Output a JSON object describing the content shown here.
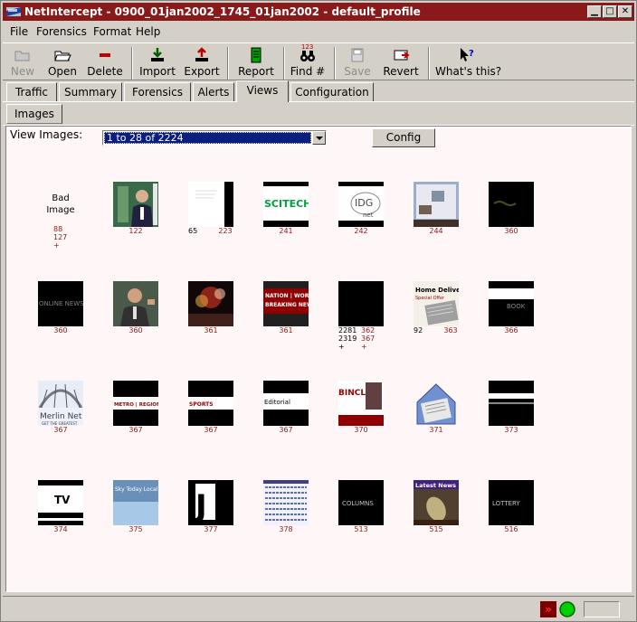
{
  "window": {
    "title": "NetIntercept - 0900_01jan2002_1745_01jan2002 - default_profile"
  },
  "menu": [
    "File",
    "Forensics",
    "Format",
    "Help"
  ],
  "toolbar": {
    "new": "New",
    "open": "Open",
    "delete": "Delete",
    "import": "Import",
    "export": "Export",
    "report": "Report",
    "find": "Find #",
    "find_badge": "123",
    "save": "Save",
    "revert": "Revert",
    "whats_this": "What's this?"
  },
  "tabs": [
    "Traffic",
    "Summary",
    "Forensics",
    "Alerts",
    "Views",
    "Configuration"
  ],
  "active_tab": "Views",
  "subtabs": [
    "Images"
  ],
  "view_images": {
    "label": "View Images:",
    "selected": "1 to 28 of 2224",
    "config_button": "Config"
  },
  "thumbnails": [
    {
      "kind": "bad",
      "label1": "Bad",
      "label2": "Image",
      "nums": [
        "88",
        "127",
        "+"
      ]
    },
    {
      "kind": "photo-man",
      "caption": "122"
    },
    {
      "kind": "doc",
      "caption_left": "65",
      "caption": "223"
    },
    {
      "kind": "scitech",
      "caption": "241",
      "text": "SCITECH"
    },
    {
      "kind": "idg",
      "caption": "242",
      "text": "IDG",
      "subtext": "net"
    },
    {
      "kind": "screenshot",
      "caption": "244"
    },
    {
      "kind": "dark-dots",
      "caption": "360"
    },
    {
      "kind": "dark-text",
      "caption": "360",
      "text": "ONLINE NEWS"
    },
    {
      "kind": "photo-man2",
      "caption": "360"
    },
    {
      "kind": "fireworks",
      "caption": "361"
    },
    {
      "kind": "breaking",
      "caption": "361",
      "text": "NATION | WORLD BREAKING NEWS"
    },
    {
      "kind": "black",
      "nums_left": [
        "2281",
        "2319",
        "+"
      ],
      "nums_right": [
        "362",
        "367",
        "+"
      ]
    },
    {
      "kind": "home-delivery",
      "caption_left": "92",
      "caption": "363",
      "text": "Home Delivery",
      "subtext": "Special Offer"
    },
    {
      "kind": "band-book",
      "caption": "366",
      "text": "BOOK"
    },
    {
      "kind": "merlin",
      "caption": "367",
      "text": "Merlin Net",
      "subtext": "GET THE GREATEST"
    },
    {
      "kind": "metro",
      "caption": "367",
      "text": "METRO | REGION"
    },
    {
      "kind": "sports",
      "caption": "367",
      "text": "SPORTS"
    },
    {
      "kind": "editorial",
      "caption": "367",
      "text": "Editorial"
    },
    {
      "kind": "bincle",
      "caption": "370",
      "text": "BINCLE"
    },
    {
      "kind": "house",
      "caption": "371"
    },
    {
      "kind": "band-white",
      "caption": "373"
    },
    {
      "kind": "tv",
      "caption": "374",
      "text": "TV"
    },
    {
      "kind": "blue",
      "caption": "375",
      "text": "Sky Today Local"
    },
    {
      "kind": "j",
      "caption": "377",
      "text": "J"
    },
    {
      "kind": "table",
      "caption": "378"
    },
    {
      "kind": "columns",
      "caption": "513",
      "text": "COLUMNS"
    },
    {
      "kind": "latest-news",
      "caption": "515",
      "text": "Latest News"
    },
    {
      "kind": "lottery",
      "caption": "516",
      "text": "LOTTERY"
    }
  ]
}
